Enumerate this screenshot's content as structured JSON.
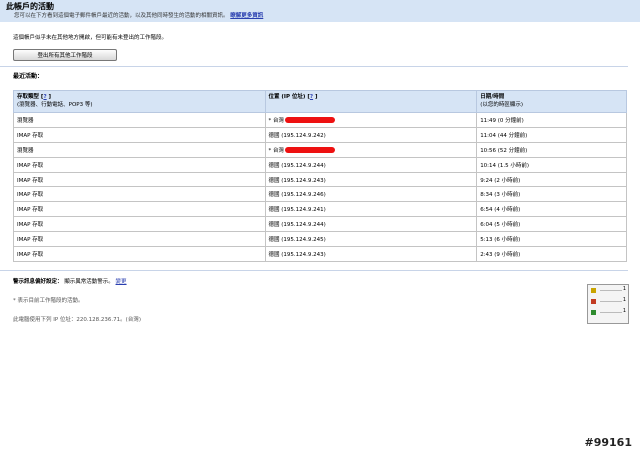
{
  "header": {
    "title": "此帳戶的活動",
    "description": "您可以在下方看到這個電子郵件帳戶最近的活動，以及其他同時發生的活動的相關資訊。",
    "learn_more": "瞭解更多資訊"
  },
  "session_note": "這個帳戶似乎未在其他地方開啟，但可能有未登出的工作階段。",
  "signout_button": "登出所有其他工作階段",
  "recent_activity": "最近活動：",
  "table": {
    "col1_title": "存取類型 [",
    "col1_help": "?",
    "col1_close": " ]",
    "col1_sub": "(瀏覽器、行動電話、POP3 等)",
    "col2_title": "位置 (IP 位址) [",
    "col2_help": "?",
    "col2_close": " ]",
    "col3_title": "日期/時間",
    "col3_sub": "(以您的時區顯示)",
    "rows": [
      {
        "type": "瀏覽器",
        "location": "* 台灣",
        "redacted": true,
        "time": "11:49 (0 分鐘前)"
      },
      {
        "type": "IMAP 存取",
        "location": "德國 (195.124.9.242)",
        "redacted": false,
        "time": "11:04 (44 分鐘前)"
      },
      {
        "type": "瀏覽器",
        "location": "* 台灣",
        "redacted": true,
        "time": "10:56 (52 分鐘前)"
      },
      {
        "type": "IMAP 存取",
        "location": "德國 (195.124.9.244)",
        "redacted": false,
        "time": "10:14 (1.5 小時前)"
      },
      {
        "type": "IMAP 存取",
        "location": "德國 (195.124.9.243)",
        "redacted": false,
        "time": "9:24 (2 小時前)"
      },
      {
        "type": "IMAP 存取",
        "location": "德國 (195.124.9.246)",
        "redacted": false,
        "time": "8:34 (3 小時前)"
      },
      {
        "type": "IMAP 存取",
        "location": "德國 (195.124.9.241)",
        "redacted": false,
        "time": "6:54 (4 小時前)"
      },
      {
        "type": "IMAP 存取",
        "location": "德國 (195.124.9.244)",
        "redacted": false,
        "time": "6:04 (5 小時前)"
      },
      {
        "type": "IMAP 存取",
        "location": "德國 (195.124.9.245)",
        "redacted": false,
        "time": "5:13 (6 小時前)"
      },
      {
        "type": "IMAP 存取",
        "location": "德國 (195.124.9.243)",
        "redacted": false,
        "time": "2:43 (9 小時前)"
      }
    ]
  },
  "alert_pref": {
    "label": "警示訊息偏好設定：",
    "value": "顯示異常活動警示。",
    "change": "變更"
  },
  "footnote": "* 表示目前工作階段的活動。",
  "ip_info": "此電腦使用下列 IP 位址：220.128.236.71。(台灣)",
  "widget": {
    "items": [
      {
        "icon": "star-icon",
        "color": "#c9a400",
        "count": "1"
      },
      {
        "icon": "folder-icon",
        "color": "#c23b22",
        "count": "1"
      },
      {
        "icon": "leaf-icon",
        "color": "#2e8b2e",
        "count": "1"
      }
    ]
  },
  "watermark": "#99161",
  "redaction_color": "#ee1111"
}
